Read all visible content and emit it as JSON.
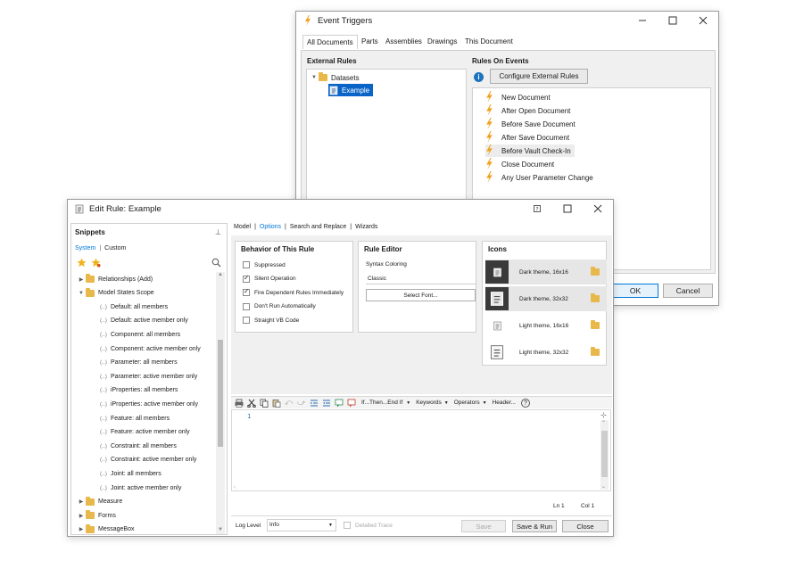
{
  "event_triggers": {
    "title": "Event Triggers",
    "tabs": [
      "All Documents",
      "Parts",
      "Assemblies",
      "Drawings",
      "This Document"
    ],
    "external_rules_label": "External Rules",
    "tree": {
      "datasets": "Datasets",
      "example": "Example"
    },
    "rules_on_events_label": "Rules On Events",
    "configure_button": "Configure External Rules",
    "events": [
      "New Document",
      "After Open Document",
      "Before Save Document",
      "After Save Document",
      "Before Vault Check-In",
      "Close Document",
      "Any User Parameter Change"
    ],
    "ok_label": "OK",
    "cancel_label": "Cancel"
  },
  "edit_rule": {
    "title": "Edit Rule: Example",
    "snippets": {
      "header": "Snippets",
      "tab_system": "System",
      "tab_custom": "Custom",
      "items": [
        {
          "label": "Relationships (Add)"
        },
        {
          "label": "Model States Scope"
        },
        {
          "label": "Default: all members"
        },
        {
          "label": "Default: active member only"
        },
        {
          "label": "Component: all members"
        },
        {
          "label": "Component: active member only"
        },
        {
          "label": "Parameter: all members"
        },
        {
          "label": "Parameter: active member only"
        },
        {
          "label": "iProperties: all members"
        },
        {
          "label": "iProperties: active member only"
        },
        {
          "label": "Feature: all members"
        },
        {
          "label": "Feature: active member only"
        },
        {
          "label": "Constraint: all members"
        },
        {
          "label": "Constraint: active member only"
        },
        {
          "label": "Joint: all members"
        },
        {
          "label": "Joint: active member only"
        },
        {
          "label": "Measure"
        },
        {
          "label": "Forms"
        },
        {
          "label": "MessageBox"
        }
      ]
    },
    "menu": {
      "model": "Model",
      "options": "Options",
      "search_replace": "Search and Replace",
      "wizards": "Wizards"
    },
    "behavior": {
      "title": "Behavior of This Rule",
      "items": [
        {
          "label": "Suppressed",
          "checked": false
        },
        {
          "label": "Silent Operation",
          "checked": true
        },
        {
          "label": "Fire Dependent Rules Immediately",
          "checked": true
        },
        {
          "label": "Don't Run Automatically",
          "checked": false
        },
        {
          "label": "Straight VB Code",
          "checked": false
        }
      ]
    },
    "rule_editor": {
      "title": "Rule Editor",
      "syntax_label": "Syntax Coloring",
      "syntax_value": "Classic",
      "font_button": "Select Font..."
    },
    "icons": {
      "title": "Icons",
      "items": [
        "Dark theme, 16x16",
        "Dark theme, 32x32",
        "Light theme, 16x16",
        "Light theme, 32x32"
      ]
    },
    "toolbar": {
      "if_then": "If...Then...End If",
      "keywords": "Keywords",
      "operators": "Operators",
      "header": "Header..."
    },
    "editor": {
      "line_number": "1"
    },
    "status": {
      "ln": "Ln 1",
      "col": "Col 1"
    },
    "bottom": {
      "log_level_label": "Log Level",
      "log_level_value": "Info",
      "detailed_trace": "Detailed Trace",
      "save": "Save",
      "save_run": "Save & Run",
      "close": "Close"
    }
  },
  "colors": {
    "accent": "#0078d7",
    "selection": "#0a64c8",
    "folder": "#e8b84b",
    "bolt": "#f0a01e",
    "info": "#1e73be"
  },
  "icons_used": [
    "lightning-icon",
    "folder-icon",
    "rule-icon",
    "info-icon",
    "star-icon",
    "search-icon",
    "pin-icon",
    "help-icon",
    "minimize-icon",
    "maximize-icon",
    "close-icon"
  ]
}
